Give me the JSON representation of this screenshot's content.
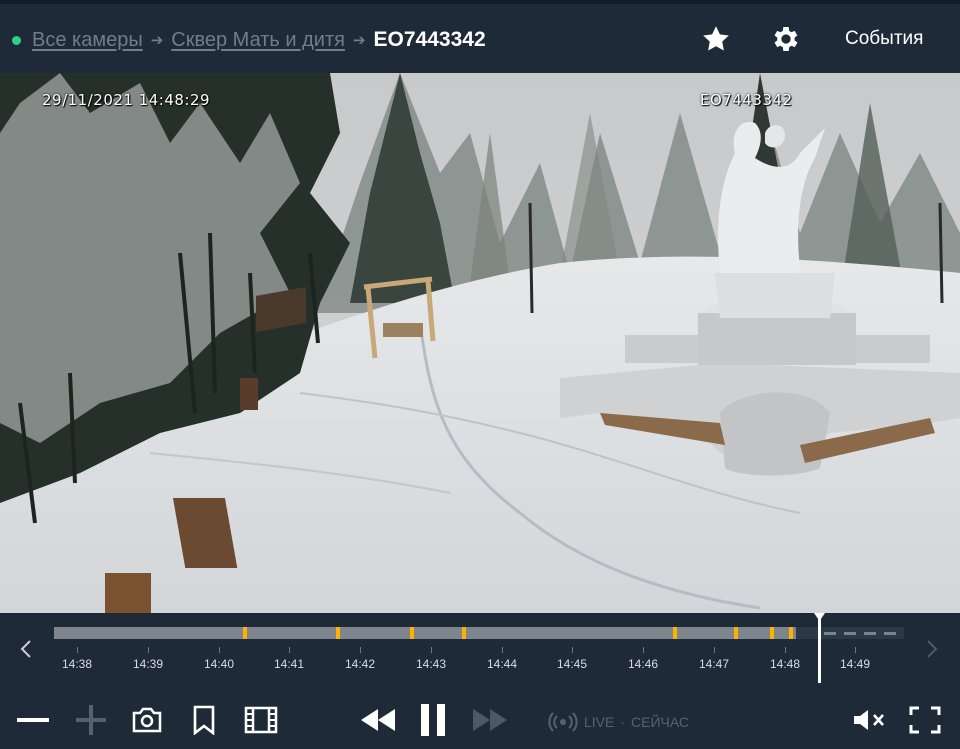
{
  "header": {
    "breadcrumb": [
      "Все камеры",
      "Сквер Мать и дитя"
    ],
    "camera_id": "ЕО7443342",
    "events_label": "События",
    "icons": [
      "star-icon",
      "gear-icon"
    ],
    "status_color": "#2fd18a"
  },
  "video": {
    "osd_timestamp": "29/11/2021 14:48:29",
    "osd_camera": "ЕО7443342"
  },
  "timeline": {
    "tick_labels": [
      "14:38",
      "14:39",
      "14:40",
      "14:41",
      "14:42",
      "14:43",
      "14:44",
      "14:45",
      "14:46",
      "14:47",
      "14:48",
      "14:49"
    ],
    "event_color": "#ffb300",
    "icons": [
      "chevron-left-icon",
      "chevron-right-icon"
    ]
  },
  "controls": {
    "live_label": "LIVE",
    "live_separator": "·",
    "now_label": "СЕЙЧАС",
    "icons": [
      "zoom-out-icon",
      "zoom-in-icon",
      "camera-icon",
      "bookmark-icon",
      "film-icon",
      "rewind-icon",
      "pause-icon",
      "fast-forward-icon",
      "broadcast-icon",
      "mute-icon",
      "fullscreen-icon"
    ]
  }
}
